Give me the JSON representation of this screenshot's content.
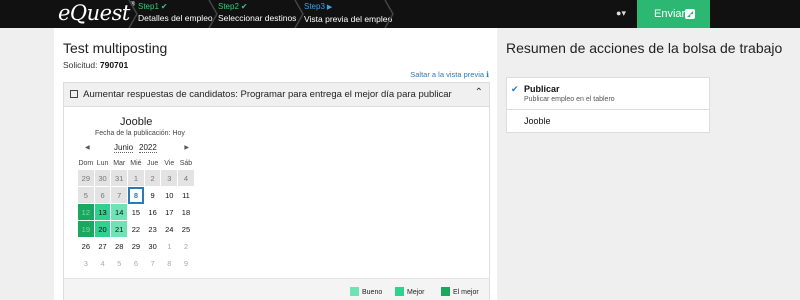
{
  "topbar": {
    "logo": "eQuest",
    "logo_mark": "®",
    "steps": [
      {
        "num": "Step1",
        "label": "Detalles del empleo",
        "state": "done"
      },
      {
        "num": "Step2",
        "label": "Seleccionar destinos",
        "state": "done"
      },
      {
        "num": "Step3",
        "label": "Vista previa del empleo",
        "state": "current"
      }
    ],
    "send_label": "Enviar"
  },
  "main": {
    "title": "Test multiposting",
    "request_label": "Solicitud:",
    "request_id": "790701",
    "preview_link": "Saltar a la vista previa",
    "panel_title": "Aumentar respuestas de candidatos: Programar para entrega el mejor día para publicar",
    "board_name": "Jooble",
    "pub_date": "Fecha de la publicación: Hoy",
    "calendar": {
      "month": "Junio",
      "year": "2022",
      "weekdays": [
        "Dom",
        "Lun",
        "Mar",
        "Mié",
        "Jue",
        "Vie",
        "Sáb"
      ],
      "weeks": [
        [
          {
            "d": "29",
            "c": "past"
          },
          {
            "d": "30",
            "c": "past"
          },
          {
            "d": "31",
            "c": "past"
          },
          {
            "d": "1",
            "c": "past"
          },
          {
            "d": "2",
            "c": "past"
          },
          {
            "d": "3",
            "c": "past"
          },
          {
            "d": "4",
            "c": "past"
          }
        ],
        [
          {
            "d": "5",
            "c": "past"
          },
          {
            "d": "6",
            "c": "past"
          },
          {
            "d": "7",
            "c": "past"
          },
          {
            "d": "8",
            "c": "today"
          },
          {
            "d": "9",
            "c": ""
          },
          {
            "d": "10",
            "c": ""
          },
          {
            "d": "11",
            "c": ""
          }
        ],
        [
          {
            "d": "12",
            "c": "past best"
          },
          {
            "d": "13",
            "c": "better"
          },
          {
            "d": "14",
            "c": "good"
          },
          {
            "d": "15",
            "c": ""
          },
          {
            "d": "16",
            "c": ""
          },
          {
            "d": "17",
            "c": ""
          },
          {
            "d": "18",
            "c": ""
          }
        ],
        [
          {
            "d": "19",
            "c": "past best"
          },
          {
            "d": "20",
            "c": "better"
          },
          {
            "d": "21",
            "c": "good"
          },
          {
            "d": "22",
            "c": ""
          },
          {
            "d": "23",
            "c": ""
          },
          {
            "d": "24",
            "c": ""
          },
          {
            "d": "25",
            "c": ""
          }
        ],
        [
          {
            "d": "26",
            "c": ""
          },
          {
            "d": "27",
            "c": ""
          },
          {
            "d": "28",
            "c": ""
          },
          {
            "d": "29",
            "c": ""
          },
          {
            "d": "30",
            "c": ""
          },
          {
            "d": "1",
            "c": "other"
          },
          {
            "d": "2",
            "c": "other"
          }
        ],
        [
          {
            "d": "3",
            "c": "other"
          },
          {
            "d": "4",
            "c": "other"
          },
          {
            "d": "5",
            "c": "other"
          },
          {
            "d": "6",
            "c": "other"
          },
          {
            "d": "7",
            "c": "other"
          },
          {
            "d": "8",
            "c": "other"
          },
          {
            "d": "9",
            "c": "other"
          }
        ]
      ]
    },
    "legend": [
      {
        "label": "Bueno",
        "color": "#6fe3b6"
      },
      {
        "label": "Mejor",
        "color": "#2ed18e"
      },
      {
        "label": "El mejor",
        "color": "#18a85e"
      }
    ]
  },
  "summary": {
    "title": "Resumen de acciones de la bolsa de trabajo",
    "items": [
      {
        "title": "Publicar",
        "subtitle": "Publicar empleo en el tablero",
        "checked": true
      },
      {
        "title": "Jooble",
        "subtitle": "",
        "checked": false
      }
    ]
  }
}
